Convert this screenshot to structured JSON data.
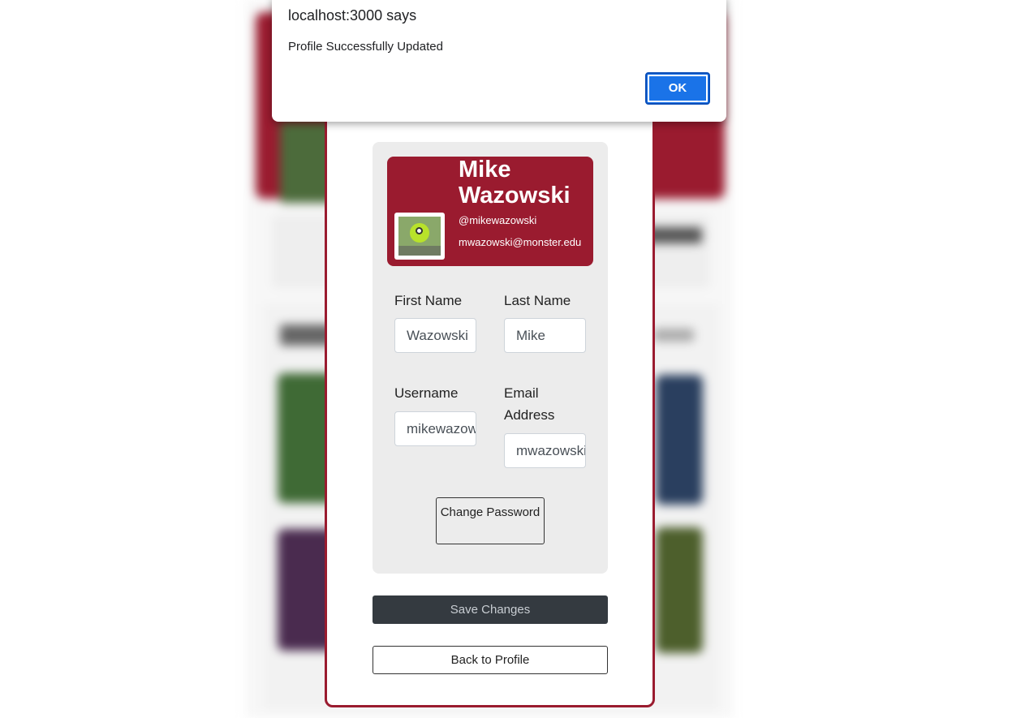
{
  "alert": {
    "title": "localhost:3000 says",
    "message": "Profile Successfully Updated",
    "ok_label": "OK"
  },
  "profile": {
    "name": "Mike Wazowski",
    "username": "@mikewazowski",
    "email": "mwazowski@monster.edu"
  },
  "form": {
    "first_name_label": "First Name",
    "first_name_value": "Wazowski",
    "last_name_label": "Last Name",
    "last_name_value": "Mike",
    "username_label": "Username",
    "username_value": "mikewazowski",
    "email_label": "Email Address",
    "email_value": "mwazowski@monster.edu",
    "change_password_label": "Change Password"
  },
  "actions": {
    "save_label": "Save Changes",
    "back_label": "Back to Profile"
  },
  "colors": {
    "brand": "#9a1b2f",
    "primary_button": "#1a73e8",
    "dark_button": "#343a40"
  }
}
